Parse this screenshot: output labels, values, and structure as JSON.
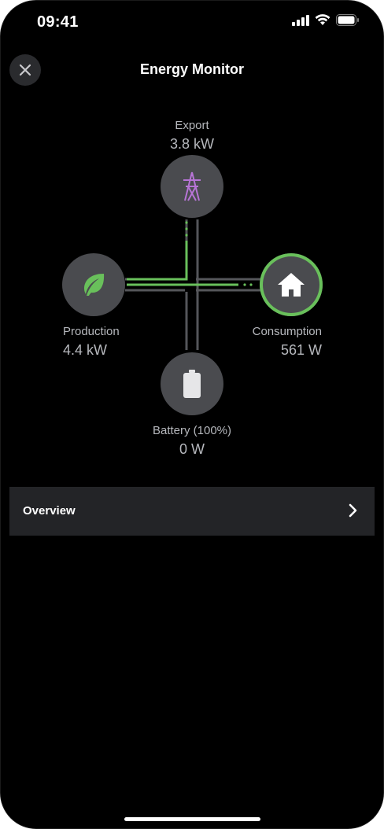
{
  "status_bar": {
    "time": "09:41"
  },
  "header": {
    "title": "Energy Monitor",
    "close_icon": "close-icon"
  },
  "nodes": {
    "export": {
      "label": "Export",
      "value": "3.8 kW",
      "icon": "transmission-tower-icon"
    },
    "production": {
      "label": "Production",
      "value": "4.4 kW",
      "icon": "leaf-icon"
    },
    "consumption": {
      "label": "Consumption",
      "value": "561 W",
      "icon": "house-icon"
    },
    "battery": {
      "label": "Battery (100%)",
      "value": "0 W",
      "icon": "battery-icon"
    }
  },
  "overview": {
    "label": "Overview",
    "icon": "chevron-right-icon"
  },
  "colors": {
    "accent_green": "#69c05b",
    "tower_purple": "#b774d6",
    "node_bg": "#4a4b4f",
    "row_bg": "#232427"
  }
}
